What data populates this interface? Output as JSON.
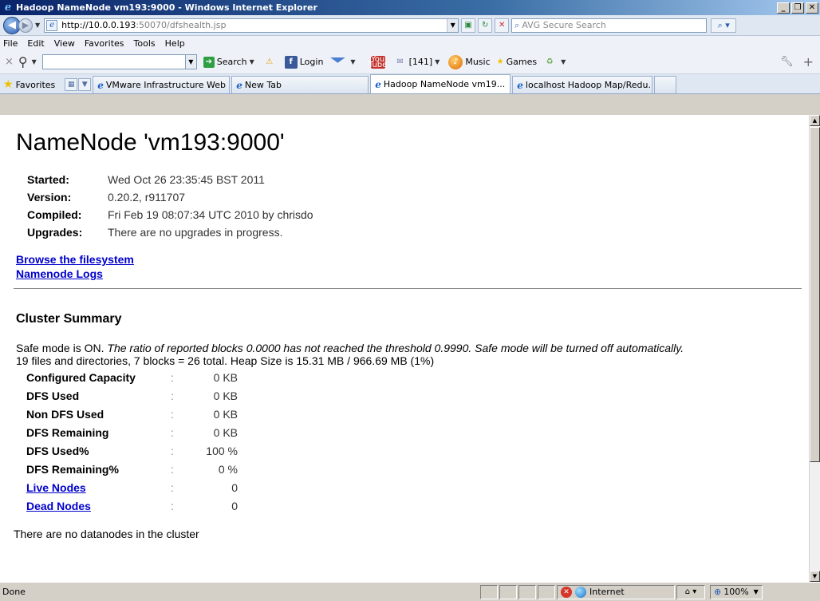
{
  "window": {
    "title": "Hadoop NameNode vm193:9000 - Windows Internet Explorer",
    "controls": [
      "_",
      "❐",
      "✕"
    ]
  },
  "address": {
    "url_host": "http://10.0.0.193",
    "url_rest": ":50070/dfshealth.jsp",
    "search_placeholder": "AVG Secure Search"
  },
  "menu": {
    "items": [
      "File",
      "Edit",
      "View",
      "Favorites",
      "Tools",
      "Help"
    ]
  },
  "toolbar": {
    "search_label": "Search",
    "login_label": "Login",
    "counter_label": "[141]",
    "music_label": "Music",
    "games_label": "Games"
  },
  "tabs": {
    "favorites_label": "Favorites",
    "items": [
      {
        "label": "VMware Infrastructure Web ..."
      },
      {
        "label": "New Tab"
      },
      {
        "label": "Hadoop NameNode vm19..."
      },
      {
        "label": "localhost Hadoop Map/Redu..."
      }
    ]
  },
  "page": {
    "title": "NameNode 'vm193:9000'",
    "info": [
      {
        "key": "Started:",
        "value": "Wed Oct 26 23:35:45 BST 2011"
      },
      {
        "key": "Version:",
        "value": "0.20.2, r911707"
      },
      {
        "key": "Compiled:",
        "value": "Fri Feb 19 08:07:34 UTC 2010 by chrisdo"
      },
      {
        "key": "Upgrades:",
        "value": "There are no upgrades in progress."
      }
    ],
    "links": {
      "browse": "Browse the filesystem",
      "logs": "Namenode Logs"
    },
    "cluster_summary_heading": "Cluster Summary",
    "safemode_prefix": "Safe mode is ON.",
    "safemode_italic": "The ratio of reported blocks 0.0000 has not reached the threshold 0.9990. Safe mode will be turned off automatically.",
    "files_line": "19 files and directories, 7 blocks = 26 total. Heap Size is 15.31 MB / 966.69 MB (1%)",
    "summary": [
      {
        "key": "Configured Capacity",
        "sep": ":",
        "value": "0 KB",
        "link": false
      },
      {
        "key": "DFS Used",
        "sep": ":",
        "value": "0 KB",
        "link": false
      },
      {
        "key": "Non DFS Used",
        "sep": ":",
        "value": "0 KB",
        "link": false
      },
      {
        "key": "DFS Remaining",
        "sep": ":",
        "value": "0 KB",
        "link": false
      },
      {
        "key": "DFS Used%",
        "sep": ":",
        "value": "100 %",
        "link": false
      },
      {
        "key": "DFS Remaining%",
        "sep": ":",
        "value": "0 %",
        "link": false
      },
      {
        "key": "Live Nodes",
        "sep": ":",
        "value": "0",
        "link": true
      },
      {
        "key": "Dead Nodes",
        "sep": ":",
        "value": "0",
        "link": true
      }
    ],
    "no_datanodes": "There are no datanodes in the cluster"
  },
  "status": {
    "text": "Done",
    "zone": "Internet",
    "zoom": "100%"
  }
}
